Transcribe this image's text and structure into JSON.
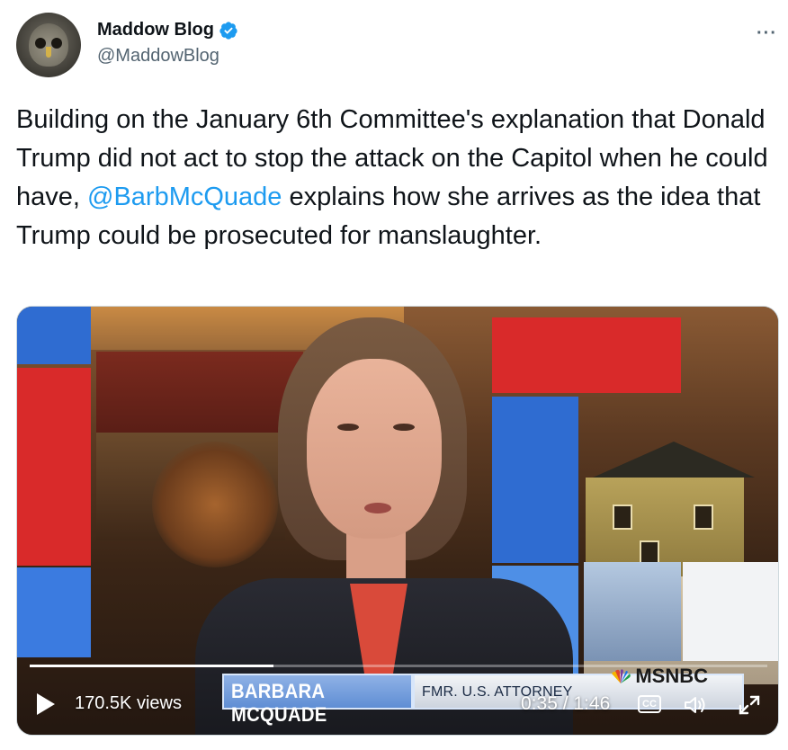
{
  "author": {
    "display_name": "Maddow Blog",
    "handle": "@MaddowBlog",
    "verified": true
  },
  "menu": {
    "more_icon": "more-horizontal-icon",
    "glyph": "···"
  },
  "tweet": {
    "text_before": "Building on the January 6th Committee's explanation that Donald Trump did not act to stop the attack on the Capitol when he could have, ",
    "mention": "@BarbMcQuade",
    "text_after": " explains how she arrives as the idea that Trump could be prosecuted for manslaughter."
  },
  "video": {
    "views": "170.5K views",
    "time": "0:35 / 1:46",
    "progress": 0.33,
    "lower_third": {
      "name": "BARBARA MCQUADE",
      "title": "FMR. U.S. ATTORNEY",
      "network": "MSNBC"
    },
    "controls": {
      "play_icon": "play-icon",
      "cc_label": "CC",
      "volume_icon": "volume-icon",
      "expand_icon": "expand-icon"
    }
  },
  "colors": {
    "link": "#1d9bf0",
    "secondary_text": "#536471",
    "verified_badge": "#1d9bf0"
  }
}
